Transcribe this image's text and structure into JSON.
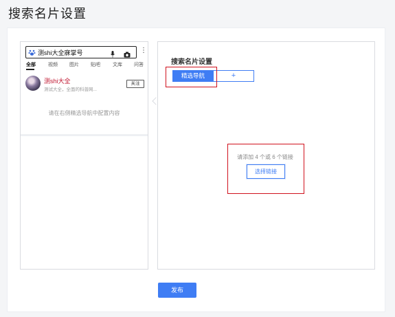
{
  "page": {
    "title": "搜索名片设置"
  },
  "preview": {
    "search_query": "测shi大全寐掌号",
    "tabs": [
      "全部",
      "视频",
      "图片",
      "贴吧",
      "文库",
      "问答"
    ],
    "active_tab": "全部",
    "result": {
      "title": "测shi大全",
      "desc": "测试大全，全面的科普网...",
      "follow_label": "关注"
    },
    "hint": "请在右侧精选导航中配置内容"
  },
  "settings": {
    "title": "搜索名片设置",
    "nav_tabs": [
      "精选导航",
      "+"
    ],
    "add_hint": "请添加 4 个或 6 个链接",
    "select_link_label": "选择链接"
  },
  "footer": {
    "publish_label": "发布"
  },
  "colors": {
    "accent": "#3f7df4",
    "highlight_red": "#d0101c",
    "result_title_red": "#c0152f"
  }
}
